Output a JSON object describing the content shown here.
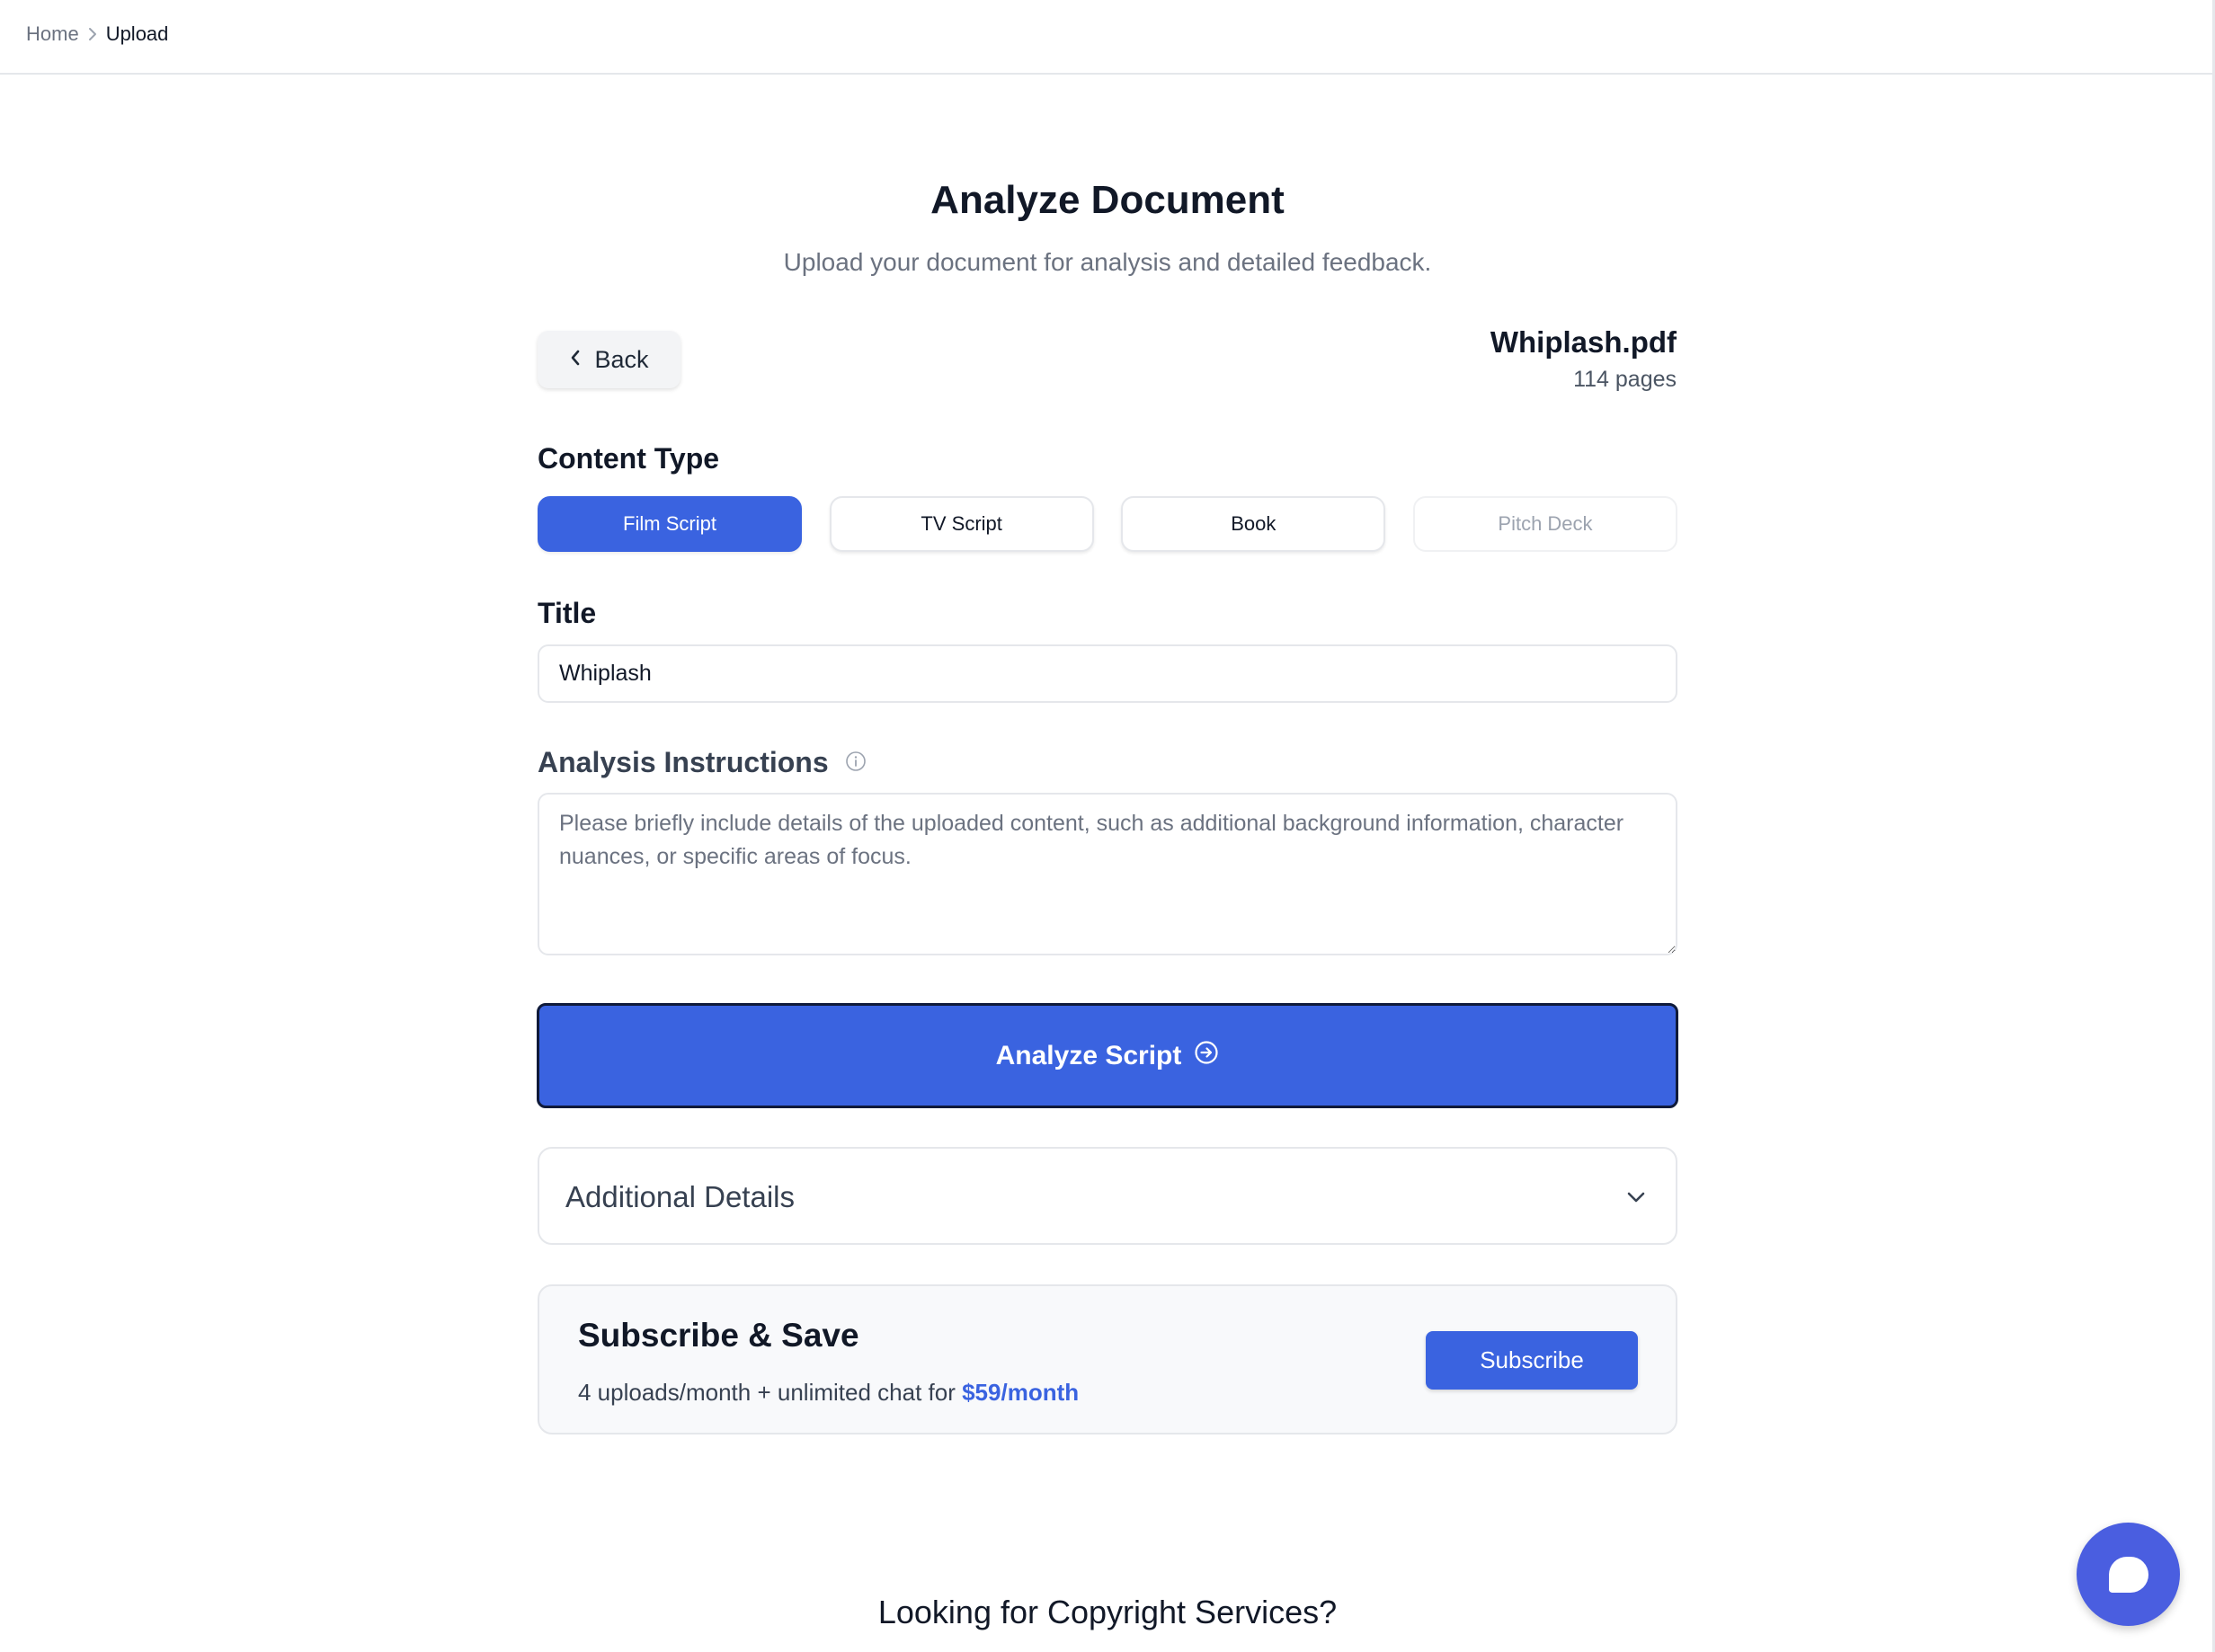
{
  "breadcrumb": {
    "home": "Home",
    "current": "Upload"
  },
  "header": {
    "title": "Analyze Document",
    "subtitle": "Upload your document for analysis and detailed feedback."
  },
  "back_label": "Back",
  "file": {
    "name": "Whiplash.pdf",
    "pages": "114 pages"
  },
  "content_type": {
    "label": "Content Type",
    "options": [
      {
        "label": "Film Script",
        "state": "selected"
      },
      {
        "label": "TV Script",
        "state": "default"
      },
      {
        "label": "Book",
        "state": "default"
      },
      {
        "label": "Pitch Deck",
        "state": "disabled"
      }
    ]
  },
  "title_field": {
    "label": "Title",
    "value": "Whiplash"
  },
  "instructions": {
    "label": "Analysis Instructions",
    "placeholder": "Please briefly include details of the uploaded content, such as additional background information, character nuances, or specific areas of focus."
  },
  "analyze_button": "Analyze Script",
  "additional_details": "Additional Details",
  "subscribe": {
    "title": "Subscribe & Save",
    "text": "4 uploads/month + unlimited chat for",
    "price": "$59/month",
    "button": "Subscribe"
  },
  "copyright_heading": "Looking for Copyright Services?",
  "colors": {
    "accent": "#3a63e0",
    "chat_fab": "#4a5ee0"
  },
  "icons": [
    "chevron-right-icon",
    "chevron-left-icon",
    "info-icon",
    "arrow-circle-right-icon",
    "chevron-down-icon",
    "chat-icon"
  ]
}
